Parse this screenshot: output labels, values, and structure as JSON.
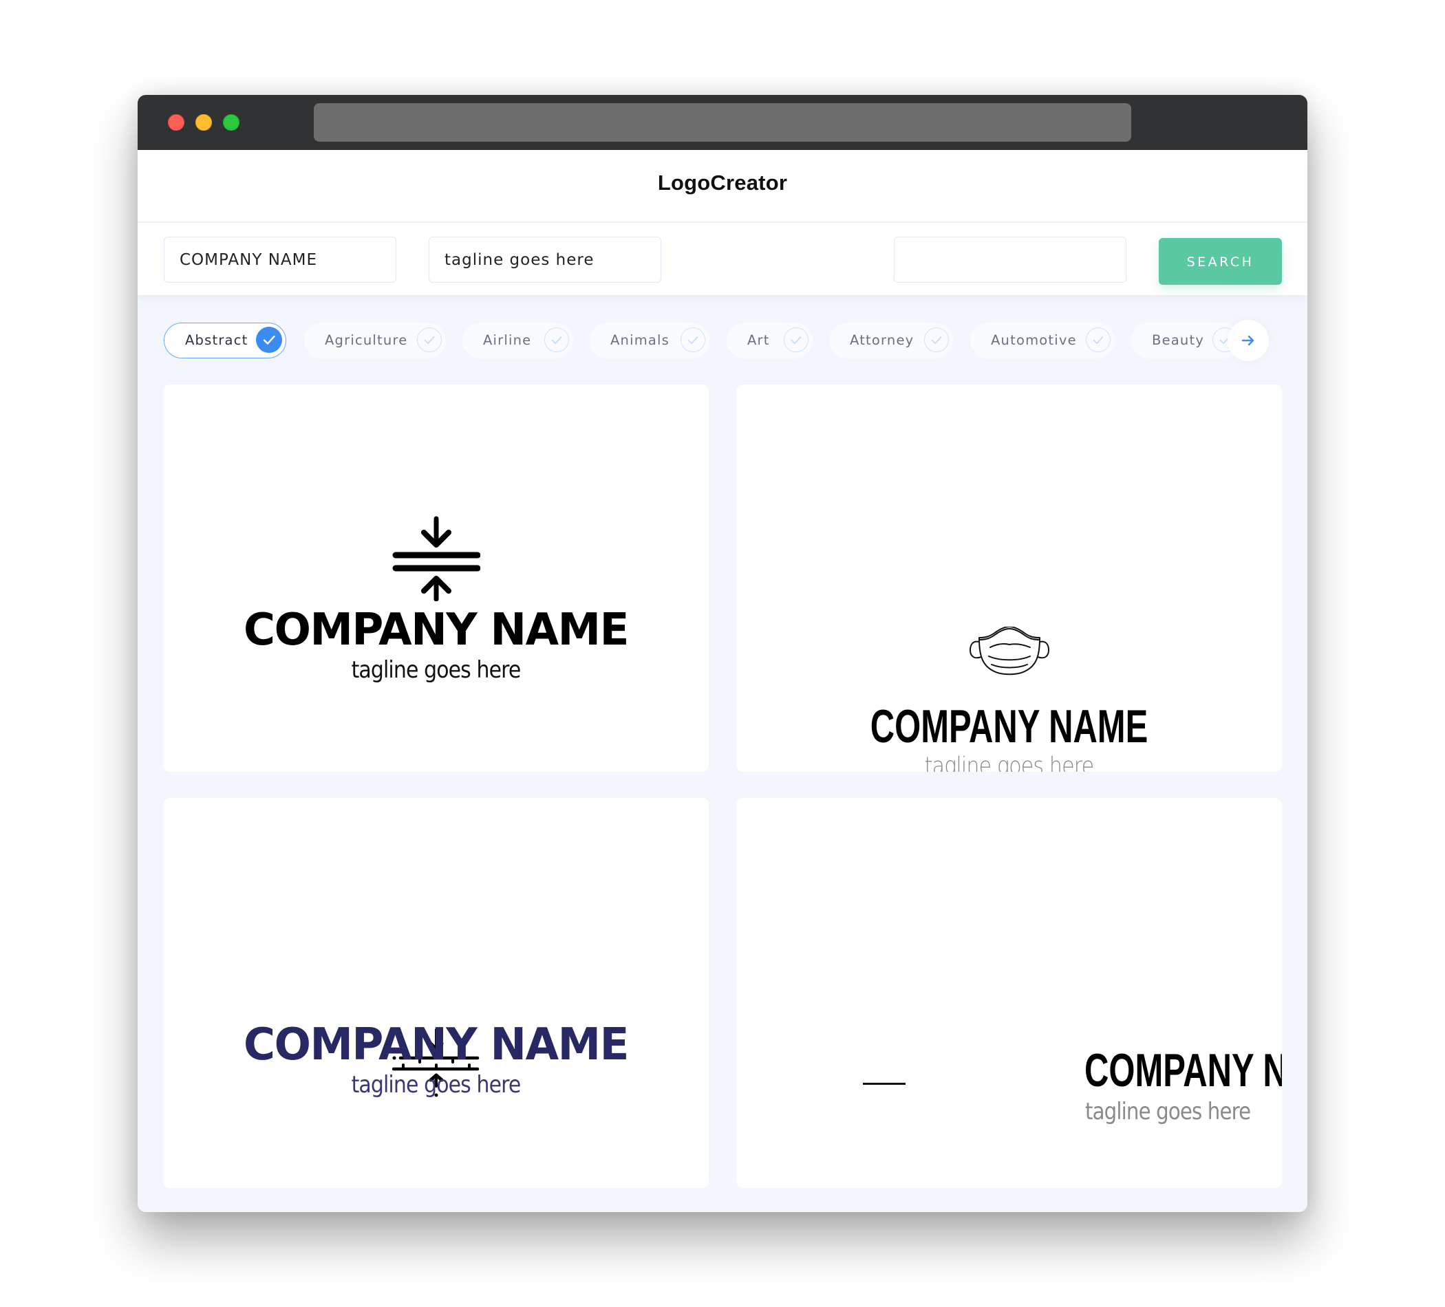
{
  "window": {
    "traffic_lights": [
      "close",
      "minimize",
      "maximize"
    ]
  },
  "header": {
    "title": "LogoCreator"
  },
  "search": {
    "company_name_value": "COMPANY NAME",
    "tagline_value": "tagline goes here",
    "keyword_value": "",
    "search_button_label": "SEARCH"
  },
  "categories": {
    "items": [
      {
        "label": "Abstract",
        "selected": true
      },
      {
        "label": "Agriculture",
        "selected": false
      },
      {
        "label": "Airline",
        "selected": false
      },
      {
        "label": "Animals",
        "selected": false
      },
      {
        "label": "Art",
        "selected": false
      },
      {
        "label": "Attorney",
        "selected": false
      },
      {
        "label": "Automotive",
        "selected": false
      },
      {
        "label": "Beauty",
        "selected": false
      }
    ],
    "next_icon": "arrow-right-icon",
    "accent_color": "#3b8cf0"
  },
  "logos": [
    {
      "icon": "compress-vertical-arrows-icon",
      "company": "COMPANY NAME",
      "tagline": "tagline goes here",
      "color": "#000000"
    },
    {
      "icon": "face-mask-icon",
      "company": "COMPANY NAME",
      "tagline": "tagline goes here",
      "color": "#000000"
    },
    {
      "icon": "compress-ruler-arrows-icon",
      "company": "COMPANY NAME",
      "tagline": "tagline goes here",
      "color": "#282864"
    },
    {
      "icon": "dash-line-icon",
      "company": "COMPANY NAME",
      "tagline": "tagline goes here",
      "color": "#000000"
    }
  ],
  "colors": {
    "search_button": "#5ac8a0",
    "chrome": "#313234",
    "page_background": "#f3f6fd"
  }
}
